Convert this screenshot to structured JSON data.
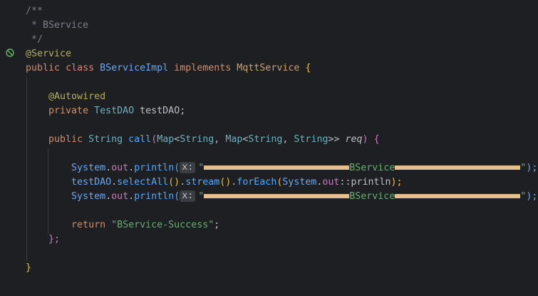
{
  "comment": {
    "open": "/**",
    "text": " * BService",
    "close": " */"
  },
  "annotation_service": "@Service",
  "class_decl": {
    "public": "public",
    "class": "class",
    "name": "BServiceImpl",
    "implements": "implements",
    "iface": "MqttService",
    "brace": "{"
  },
  "field": {
    "annotation": "@Autowired",
    "private": "private",
    "type": "TestDAO",
    "name": "testDAO;"
  },
  "method": {
    "public": "public",
    "return_type": "String",
    "name": "call",
    "paren_open": "(",
    "param_type_1": "Map",
    "lt1": "<",
    "param_type_2": "String",
    "comma1": ", ",
    "param_type_3": "Map",
    "lt2": "<",
    "param_type_4": "String",
    "comma2": ", ",
    "param_type_5": "String",
    "gt": ">>",
    "param_name": "req",
    "paren_close": ")",
    "brace": "{"
  },
  "body": {
    "line1": {
      "system": "System",
      "dot1": ".",
      "out": "out",
      "dot2": ".",
      "println": "println",
      "paren": "(",
      "hint": "x:",
      "quote_open": "\"",
      "label": "BService",
      "quote_close": "\"",
      "end": ");"
    },
    "line2": {
      "obj": "testDAO",
      "dot1": ".",
      "m1": "selectAll",
      "p1": "()",
      "dot2": ".",
      "m2": "stream",
      "p2": "()",
      "dot3": ".",
      "m3": "forEach",
      "paren": "(",
      "system": "System",
      "dot4": ".",
      "out": "out",
      "ref": "::",
      "println": "println",
      "end": ");"
    },
    "line3": {
      "system": "System",
      "dot1": ".",
      "out": "out",
      "dot2": ".",
      "println": "println",
      "paren": "(",
      "hint": "x:",
      "quote_open": "\"",
      "label": "BService",
      "quote_close": "\"",
      "end": ");"
    },
    "return_kw": "return",
    "return_value": "\"BService-Success\"",
    "return_end": ";"
  },
  "method_close": "};",
  "class_close": "}"
}
